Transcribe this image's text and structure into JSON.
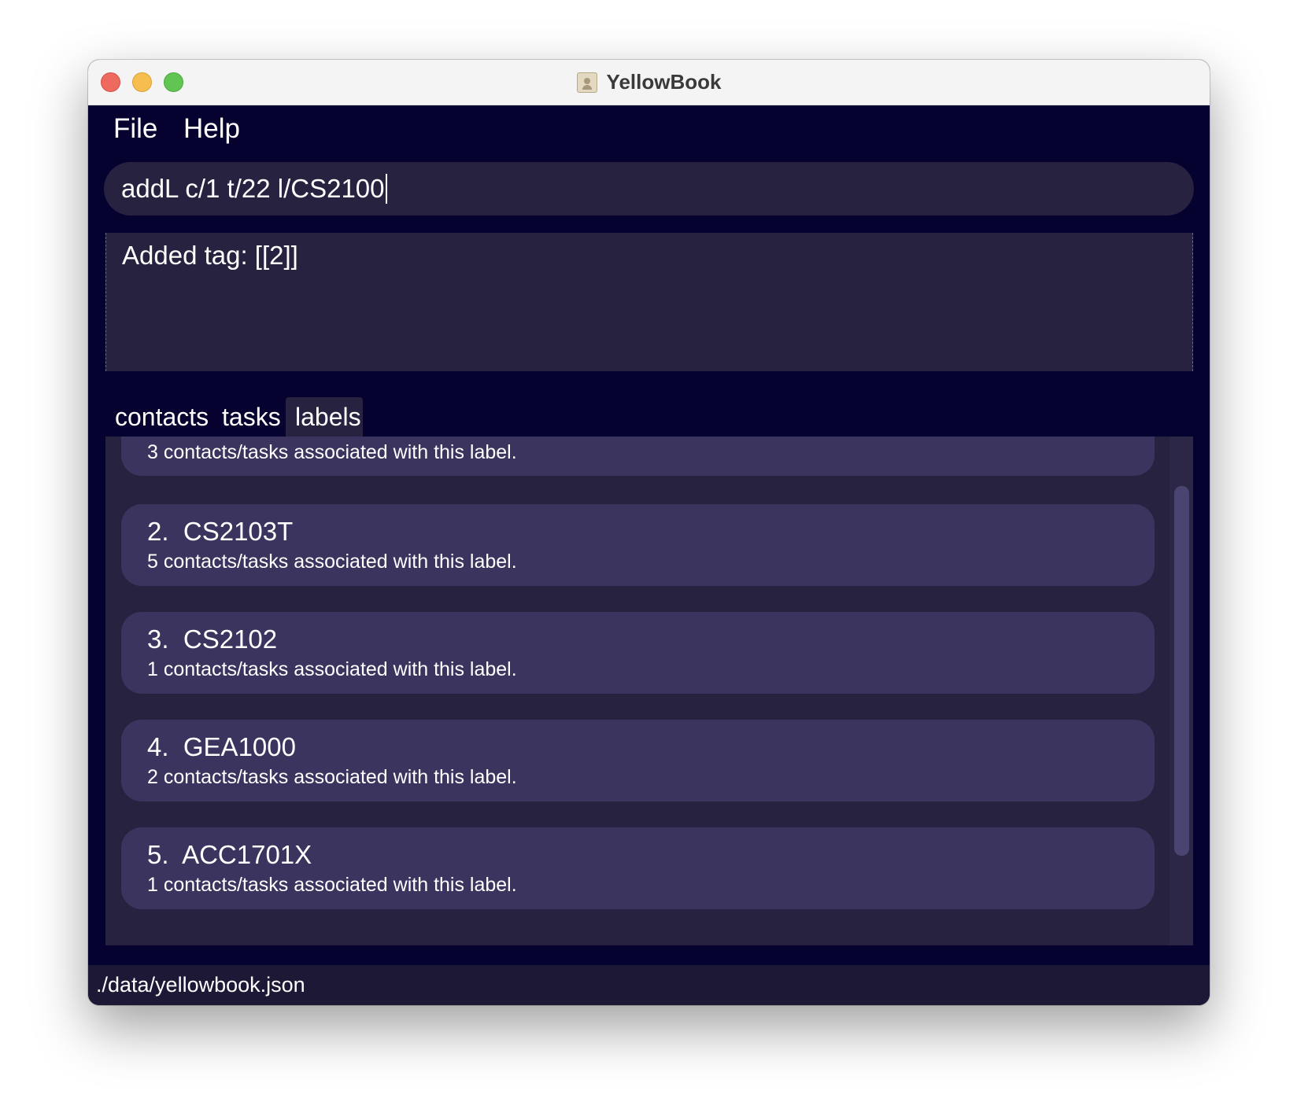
{
  "window": {
    "title": "YellowBook"
  },
  "menu": {
    "items": [
      "File",
      "Help"
    ]
  },
  "command": {
    "value": "addL c/1 t/22 l/CS2100"
  },
  "result": {
    "text": "Added tag: [[2]]"
  },
  "tabs": {
    "items": [
      "contacts",
      "tasks",
      "labels"
    ],
    "active": "labels"
  },
  "labels": {
    "partial_desc": "3 contacts/tasks associated with this label.",
    "items": [
      {
        "index": "2.",
        "name": "CS2103T",
        "desc": "5 contacts/tasks associated with this label."
      },
      {
        "index": "3.",
        "name": "CS2102",
        "desc": "1 contacts/tasks associated with this label."
      },
      {
        "index": "4.",
        "name": "GEA1000",
        "desc": "2 contacts/tasks associated with this label."
      },
      {
        "index": "5.",
        "name": "ACC1701X",
        "desc": "1 contacts/tasks associated with this label."
      }
    ]
  },
  "status": {
    "path": "./data/yellowbook.json"
  },
  "colors": {
    "background": "#050230",
    "panel": "#27223f",
    "card": "#3b345e",
    "text": "#ffffff"
  }
}
